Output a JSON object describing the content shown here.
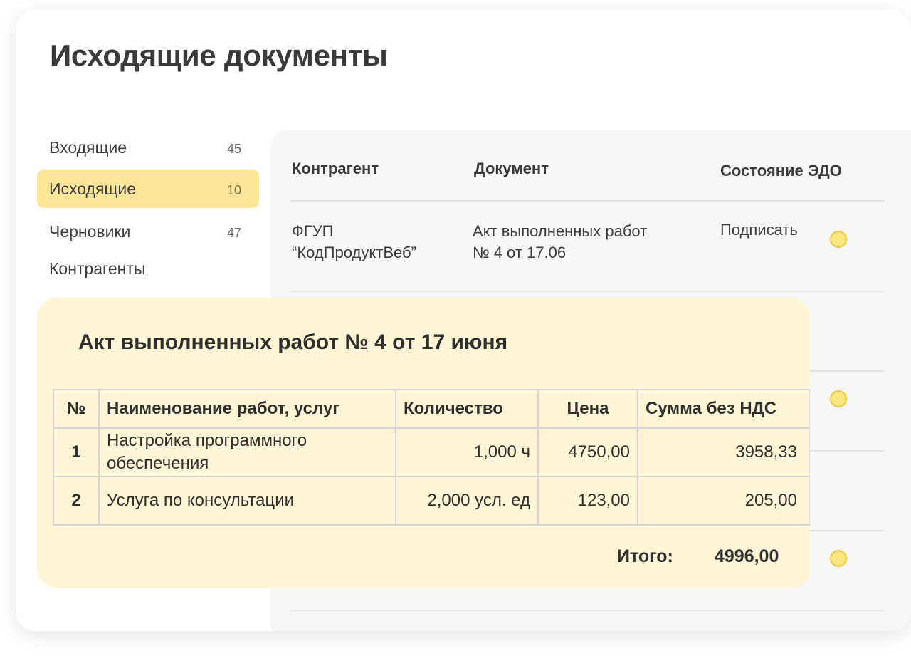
{
  "page": {
    "title": "Исходящие документы"
  },
  "sidebar": {
    "items": [
      {
        "label": "Входящие",
        "count": "45"
      },
      {
        "label": "Исходящие",
        "count": "10",
        "active": true
      },
      {
        "label": "Черновики",
        "count": "47"
      },
      {
        "label": "Контрагенты",
        "count": ""
      }
    ]
  },
  "documents": {
    "columns": {
      "counterparty": "Контрагент",
      "document": "Документ",
      "status": "Состояние ЭДО"
    },
    "rows": [
      {
        "counterparty_line1": "ФГУП",
        "counterparty_line2": "“КодПродуктВеб”",
        "document_line1": "Акт выполненных работ",
        "document_line2": "№ 4 от 17.06",
        "status": "Подписать",
        "status_icon": "status-dot-icon"
      }
    ],
    "status_color": "#fbe57e"
  },
  "act": {
    "title": "Акт выполненных работ № 4 от 17 июня",
    "headers": {
      "num": "№",
      "name": "Наименование работ, услуг",
      "qty": "Количество",
      "price": "Цена",
      "sum": "Сумма без НДС"
    },
    "rows": [
      {
        "num": "1",
        "name": "Настройка программного обеспечения",
        "qty": "1,000 ч",
        "price": "4750,00",
        "sum": "3958,33"
      },
      {
        "num": "2",
        "name": "Услуга по консультации",
        "qty": "2,000 усл. ед",
        "price": "123,00",
        "sum": "205,00"
      }
    ],
    "total_label": "Итого:",
    "total_value": "4996,00",
    "background_color": "#fef6d7"
  }
}
